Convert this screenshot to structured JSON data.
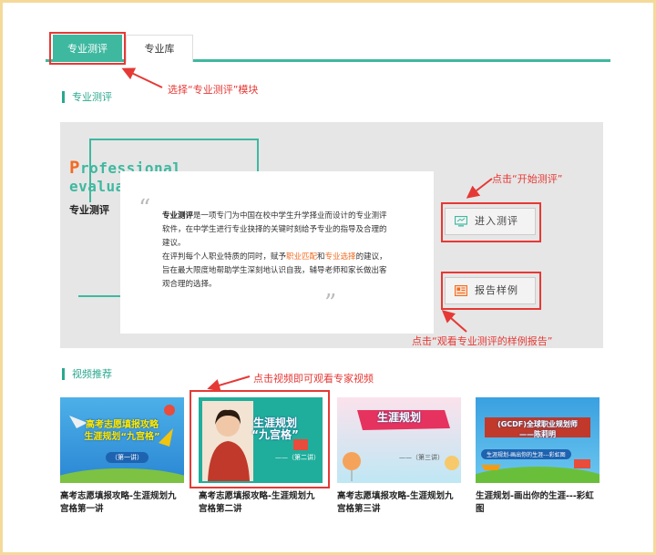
{
  "tabs": [
    {
      "label": "专业测评",
      "active": true
    },
    {
      "label": "专业库",
      "active": false
    }
  ],
  "eval_section": {
    "title": "专业测评",
    "prof_line1_first": "P",
    "prof_line1_rest": "rofessional",
    "prof_line2": "evaluation",
    "subtitle": "专业测评",
    "desc_bold": "专业测评",
    "desc_p1_rest": "是一项专门为中国在校中学生升学择业而设计的专业测评软件，在中学生进行专业抉择的关键时刻给予专业的指导及合理的建议。",
    "desc_p2_a": "在评判每个人职业特质的同时，赋予",
    "desc_hl1": "职业匹配",
    "desc_p2_b": "和",
    "desc_hl2": "专业选择",
    "desc_p2_c": "的建议，旨在最大限度地帮助学生深刻地认识自我，辅导老师和家长做出客观合理的选择。",
    "start_button": "进入测评",
    "sample_button": "报告样例"
  },
  "video_section": {
    "title": "视频推荐",
    "items": [
      {
        "caption": "高考志愿填报攻略-生涯规划九宫格第一讲",
        "overlay": "高考志愿填报攻略\n生涯规划“九宫格”",
        "episode": "（第一讲）"
      },
      {
        "caption": "高考志愿填报攻略-生涯规划九宫格第二讲",
        "overlay": "生涯规划\n“九宫格”",
        "episode": "——（第二讲）"
      },
      {
        "caption": "高考志愿填报攻略-生涯规划九宫格第三讲",
        "overlay": "生涯规划",
        "episode": "——（第三讲）"
      },
      {
        "caption": "生涯规划-画出你的生涯---彩虹图",
        "overlay": "(GCDF)全球职业规划师\n——陈莉明",
        "episode": "生涯规划-画出你的生涯---彩虹图"
      }
    ]
  },
  "annotations": {
    "tab_hint": "选择“专业测评”模块",
    "start_hint": "点击“开始测评”",
    "sample_hint": "点击“观看专业测评的样例报告”",
    "video_hint": "点击视频即可观看专家视频"
  },
  "colors": {
    "accent": "#3fb8a0",
    "annotation": "#e53935",
    "frame": "#f5d99a",
    "highlight": "#f26b21"
  }
}
